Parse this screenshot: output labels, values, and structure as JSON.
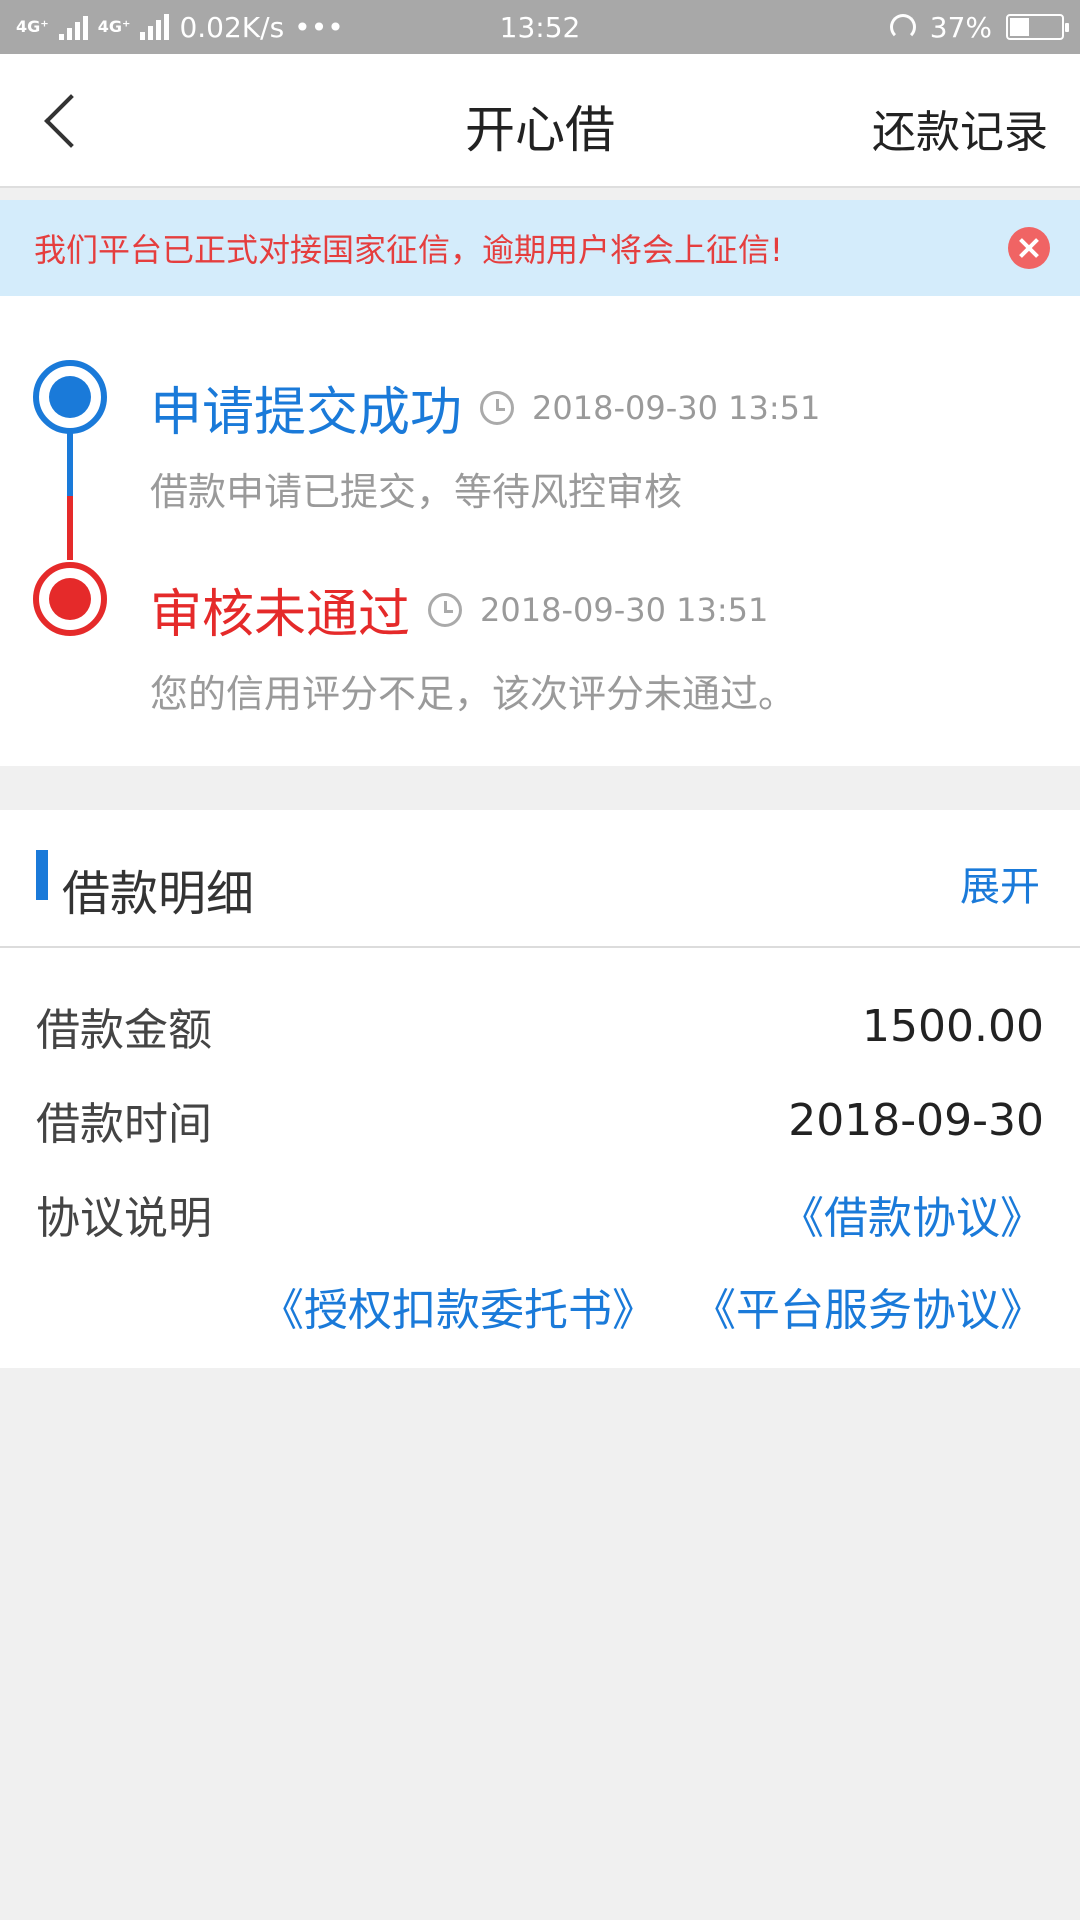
{
  "status_bar": {
    "network_1": "4G⁺",
    "network_2": "4G⁺",
    "speed": "0.02K/s",
    "dots": "•••",
    "time": "13:52",
    "battery": "37%",
    "battery_level": 0.37
  },
  "header": {
    "title": "开心借",
    "right_link": "还款记录"
  },
  "notice": {
    "text": "我们平台已正式对接国家征信，逾期用户将会上征信!"
  },
  "timeline": {
    "items": [
      {
        "status": "申请提交成功",
        "time": "2018-09-30 13:51",
        "desc": "借款申请已提交，等待风控审核",
        "color": "#1a7ad9"
      },
      {
        "status": "审核未通过",
        "time": "2018-09-30 13:51",
        "desc": "您的信用评分不足，该次评分未通过。",
        "color": "#e52a2a"
      }
    ]
  },
  "detail": {
    "title": "借款明细",
    "expand": "展开",
    "rows": [
      {
        "label": "借款金额",
        "value": "1500.00"
      },
      {
        "label": "借款时间",
        "value": "2018-09-30"
      },
      {
        "label": "协议说明",
        "value": "《借款协议》"
      }
    ],
    "agreements": [
      "《授权扣款委托书》",
      "《平台服务协议》"
    ]
  },
  "colors": {
    "accent_blue": "#1a7ad9",
    "accent_red": "#e52a2a",
    "notice_bg": "#d4ecfb"
  }
}
